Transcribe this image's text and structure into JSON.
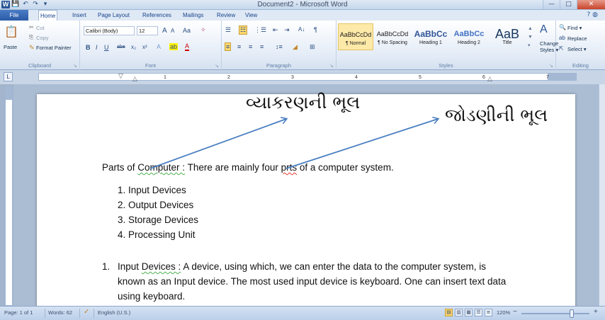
{
  "window": {
    "title": "Document2 - Microsoft Word",
    "word_logo": "W",
    "qat_save": "💾",
    "qat_undo": "↶",
    "qat_redo": "↷",
    "qat_more": "▾",
    "minimize": "—",
    "maximize": "□",
    "close": "✕",
    "help": "? ◍"
  },
  "tabs": [
    "File",
    "Home",
    "Insert",
    "Page Layout",
    "References",
    "Mailings",
    "Review",
    "View"
  ],
  "active_tab": "Home",
  "ribbon": {
    "clipboard": {
      "paste": "Paste",
      "cut": "Cut",
      "copy": "Copy",
      "format_painter": "Format Painter",
      "label": "Clipboard"
    },
    "font": {
      "font_name": "Calibri (Body)",
      "font_size": "12",
      "grow": "A",
      "shrink": "A",
      "case": "Aa",
      "bold": "B",
      "italic": "I",
      "underline": "U",
      "strike": "abe",
      "subscript": "x₂",
      "superscript": "x²",
      "label": "Font"
    },
    "paragraph": {
      "label": "Paragraph",
      "sort": "A↓",
      "pilcrow": "¶"
    },
    "styles": {
      "items": [
        {
          "sample": "AaBbCcDd",
          "name": "¶ Normal"
        },
        {
          "sample": "AaBbCcDd",
          "name": "¶ No Spacing"
        },
        {
          "sample": "AaBbCc",
          "name": "Heading 1"
        },
        {
          "sample": "AaBbCc",
          "name": "Heading 2"
        },
        {
          "sample": "AaB",
          "name": "Title"
        }
      ],
      "change_styles_1": "Change",
      "change_styles_2": "Styles ▾",
      "label": "Styles"
    },
    "editing": {
      "find": "Find ▾",
      "replace": "Replace",
      "select": "Select ▾",
      "label": "Editing"
    }
  },
  "ruler": {
    "corner": "L",
    "ticks": [
      "1",
      "2",
      "3",
      "4",
      "5",
      "6",
      "7"
    ]
  },
  "annotations": {
    "grammar_error": "વ્યાકરણની ભૂલ",
    "spelling_error": "જોડણીની ભૂલ"
  },
  "document": {
    "intro_prefix": "Parts of ",
    "intro_word_grammar": "Computer :",
    "intro_mid": " There are mainly four ",
    "intro_word_spelling": "prts",
    "intro_suffix": " of a computer system.",
    "list": [
      "1.   Input Devices",
      "2.   Output Devices",
      "3.   Storage Devices",
      "4.   Processing Unit"
    ],
    "para_num": "1.",
    "para_lead": "Input ",
    "para_underlined": "Devices :",
    "para_line1": " A device, using which, we can enter the data to the computer system, is",
    "para_line2": "known as an Input device. The most used input device is keyboard. One can insert text data",
    "para_line3": "using keyboard."
  },
  "statusbar": {
    "page": "Page: 1 of 1",
    "words": "Words: 62",
    "language": "English (U.S.)",
    "zoom": "120%",
    "zoom_out": "−",
    "zoom_in": "+"
  },
  "colors": {
    "arrow": "#4a7fc1",
    "grammar_squiggle": "#4caf50",
    "spelling_squiggle": "#e53935"
  }
}
